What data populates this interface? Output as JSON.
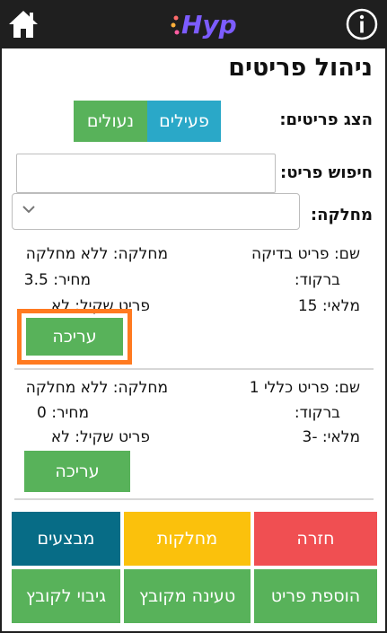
{
  "app": {
    "logo_text": "Hyp"
  },
  "page": {
    "title": "ניהול פריטים"
  },
  "filter": {
    "show_label": "הצג פריטים:",
    "active_label": "פעילים",
    "locked_label": "נעולים",
    "search_label": "חיפוש פריט:",
    "search_value": "",
    "department_label": "מחלקה:",
    "department_value": ""
  },
  "items": [
    {
      "name": "שם: פריט בדיקה",
      "department": "מחלקה: ללא מחלקה",
      "barcode": "ברקוד:",
      "price": "מחיר: 3.5",
      "stock": "מלאי: 15",
      "weighable": "פריט שקיל: לא",
      "edit_label": "עריכה"
    },
    {
      "name": "שם: פריט כללי 1",
      "department": "מחלקה: ללא מחלקה",
      "barcode": "ברקוד:",
      "price": "מחיר: 0",
      "stock": "מלאי: -3",
      "weighable": "פריט שקיל: לא",
      "edit_label": "עריכה"
    }
  ],
  "actions": {
    "back": "חזרה",
    "departments": "מחלקות",
    "promotions": "מבצעים",
    "add_item": "הוספת פריט",
    "load_file": "טעינה מקובץ",
    "backup_file": "גיבוי לקובץ"
  },
  "colors": {
    "header_bg": "#1f1f1f",
    "green": "#58b25a",
    "teal": "#2aa8c8",
    "red": "#f04f52",
    "yellow": "#fbc10c",
    "dark_teal": "#076c86",
    "highlight": "#ff7a20"
  }
}
